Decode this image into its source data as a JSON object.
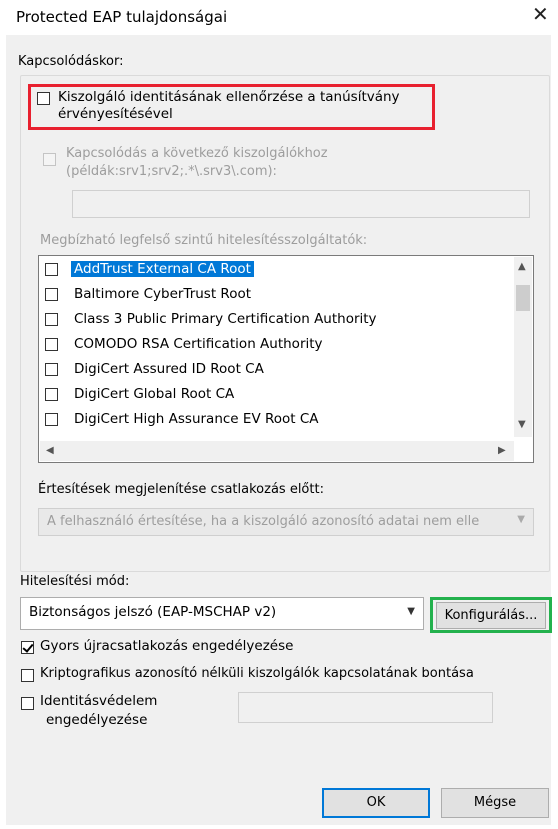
{
  "window": {
    "title": "Protected EAP tulajdonságai",
    "close_glyph": "✕"
  },
  "connection": {
    "group_label": "Kapcsolódáskor:",
    "verify_identity_label": "Kiszolgáló identitásának ellenőrzése a tanúsítvány érvényesítésével",
    "verify_identity_checked": false,
    "connect_to_servers_label_line1": "Kapcsolódás a következő kiszolgálókhoz",
    "connect_to_servers_label_line2": "(példák:srv1;srv2;.*\\.srv3\\.com):",
    "servers_value": "",
    "trusted_roots_label": "Megbízható legfelső szintű hitelesítésszolgáltatók:",
    "trusted_roots": [
      {
        "label": "AddTrust External CA Root",
        "checked": false,
        "selected": true
      },
      {
        "label": "Baltimore CyberTrust Root",
        "checked": false,
        "selected": false
      },
      {
        "label": "Class 3 Public Primary Certification Authority",
        "checked": false,
        "selected": false
      },
      {
        "label": "COMODO RSA Certification Authority",
        "checked": false,
        "selected": false
      },
      {
        "label": "DigiCert Assured ID Root CA",
        "checked": false,
        "selected": false
      },
      {
        "label": "DigiCert Global Root CA",
        "checked": false,
        "selected": false
      },
      {
        "label": "DigiCert High Assurance EV Root CA",
        "checked": false,
        "selected": false
      }
    ],
    "notifications_label": "Értesítések megjelenítése csatlakozás előtt:",
    "notifications_value": "A felhasználó értesítése, ha a kiszolgáló azonosító adatai nem elle"
  },
  "auth": {
    "method_label": "Hitelesítési mód:",
    "method_value": "Biztonságos jelszó (EAP-MSCHAP v2)",
    "configure_label": "Konfigurálás...",
    "fast_reconnect_label": "Gyors újracsatlakozás engedélyezése",
    "fast_reconnect_checked": true,
    "disconnect_label": "Kriptografikus azonosító nélküli kiszolgálók kapcsolatának bontása",
    "disconnect_checked": false,
    "identity_privacy_label_line1": "Identitásvédelem",
    "identity_privacy_label_line2": "engedélyezése",
    "identity_privacy_checked": false,
    "identity_value": ""
  },
  "footer": {
    "ok_label": "OK",
    "cancel_label": "Mégse"
  },
  "colors": {
    "highlight_red": "#e8202f",
    "highlight_green": "#23b14d",
    "selection": "#0078d7"
  }
}
